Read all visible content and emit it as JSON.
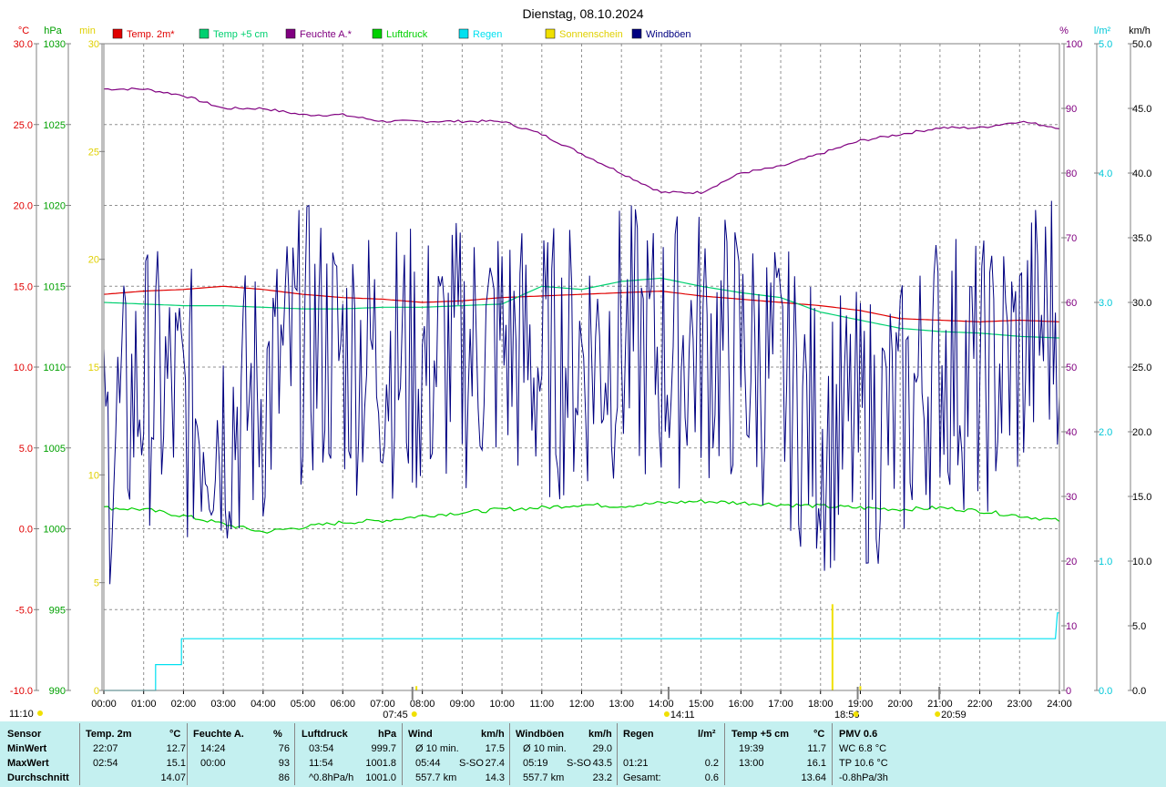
{
  "title": "Dienstag, 08.10.2024",
  "time_marker": "11:10",
  "axis_units": {
    "temp": "°C",
    "pressure": "hPa",
    "sun": "min",
    "humidity": "%",
    "rain": "l/m²",
    "wind": "km/h"
  },
  "legend": [
    {
      "label": "Temp. 2m*",
      "color": "#e00000"
    },
    {
      "label": "Temp +5 cm",
      "color": "#00d070"
    },
    {
      "label": "Feuchte A.*",
      "color": "#800080"
    },
    {
      "label": "Luftdruck",
      "color": "#00d000"
    },
    {
      "label": "Regen",
      "color": "#00e0f0"
    },
    {
      "label": "Sonnenschein",
      "color": "#f0e000"
    },
    {
      "label": "Windböen",
      "color": "#000080"
    }
  ],
  "events": [
    {
      "time": "07:45",
      "label": "07:45"
    },
    {
      "time": "14:11",
      "label": "14:11"
    },
    {
      "time": "18:56",
      "label": "18:56"
    },
    {
      "time": "20:59",
      "label": "20:59"
    }
  ],
  "chart_data": {
    "type": "line",
    "title": "Dienstag, 08.10.2024",
    "x_ticks": [
      "00:00",
      "01:00",
      "02:00",
      "03:00",
      "04:00",
      "05:00",
      "06:00",
      "07:00",
      "08:00",
      "09:00",
      "10:00",
      "11:00",
      "12:00",
      "13:00",
      "14:00",
      "15:00",
      "16:00",
      "17:00",
      "18:00",
      "19:00",
      "20:00",
      "21:00",
      "22:00",
      "23:00",
      "24:00"
    ],
    "axes": {
      "temp": {
        "unit": "°C",
        "range": [
          -10,
          30
        ],
        "ticks": [
          "-10.0",
          "-5.0",
          "0.0",
          "5.0",
          "10.0",
          "15.0",
          "20.0",
          "25.0",
          "30.0"
        ]
      },
      "pressure": {
        "unit": "hPa",
        "range": [
          990,
          1030
        ],
        "ticks": [
          "990",
          "995",
          "1000",
          "1005",
          "1010",
          "1015",
          "1020",
          "1025",
          "1030"
        ]
      },
      "sun": {
        "unit": "min",
        "range": [
          0,
          30
        ],
        "ticks": [
          "0",
          "5",
          "10",
          "15",
          "20",
          "25",
          "30"
        ]
      },
      "humidity": {
        "unit": "%",
        "range": [
          0,
          100
        ],
        "ticks": [
          "0",
          "10",
          "20",
          "30",
          "40",
          "50",
          "60",
          "70",
          "80",
          "90",
          "100"
        ]
      },
      "rain": {
        "unit": "l/m²",
        "range": [
          0,
          5
        ],
        "ticks": [
          "0.0",
          "1.0",
          "2.0",
          "3.0",
          "4.0",
          "5.0"
        ]
      },
      "wind": {
        "unit": "km/h",
        "range": [
          0,
          50
        ],
        "ticks": [
          "0.0",
          "5.0",
          "10.0",
          "15.0",
          "20.0",
          "25.0",
          "30.0",
          "35.0",
          "40.0",
          "45.0",
          "50.0"
        ]
      }
    },
    "series": [
      {
        "name": "Temp. 2m*",
        "axis": "temp",
        "color": "#e00000",
        "x": [
          0,
          1,
          2,
          3,
          4,
          5,
          6,
          7,
          8,
          9,
          10,
          11,
          12,
          13,
          14,
          15,
          16,
          17,
          18,
          19,
          20,
          21,
          22,
          23,
          24
        ],
        "y": [
          14.5,
          14.7,
          14.8,
          15.0,
          14.8,
          14.5,
          14.3,
          14.2,
          14.0,
          14.1,
          14.3,
          14.4,
          14.5,
          14.6,
          14.7,
          14.4,
          14.2,
          14.0,
          13.8,
          13.5,
          13.0,
          12.9,
          12.8,
          12.9,
          12.8
        ]
      },
      {
        "name": "Temp +5 cm",
        "axis": "temp",
        "color": "#00d070",
        "x": [
          0,
          1,
          2,
          3,
          4,
          5,
          6,
          7,
          8,
          9,
          10,
          11,
          12,
          13,
          14,
          15,
          16,
          17,
          18,
          19,
          20,
          21,
          22,
          23,
          24
        ],
        "y": [
          14.0,
          13.9,
          13.8,
          13.8,
          13.7,
          13.6,
          13.6,
          13.7,
          13.7,
          13.8,
          13.9,
          15.0,
          14.8,
          15.3,
          15.5,
          15.0,
          14.6,
          14.3,
          13.4,
          12.9,
          12.4,
          12.2,
          12.1,
          11.9,
          11.8
        ]
      },
      {
        "name": "Feuchte A.*",
        "axis": "humidity",
        "color": "#800080",
        "x": [
          0,
          1,
          2,
          3,
          4,
          5,
          6,
          7,
          8,
          9,
          10,
          11,
          12,
          13,
          14,
          15,
          16,
          17,
          18,
          19,
          20,
          21,
          22,
          23,
          24
        ],
        "y": [
          93,
          93,
          92,
          90,
          90,
          89,
          89,
          88,
          88,
          88,
          88,
          86,
          83,
          80,
          77,
          77,
          80,
          81,
          83,
          85,
          86,
          87,
          87,
          88,
          87
        ]
      },
      {
        "name": "Luftdruck",
        "axis": "pressure",
        "color": "#00d000",
        "x": [
          0,
          1,
          2,
          3,
          4,
          5,
          6,
          7,
          8,
          9,
          10,
          11,
          12,
          13,
          14,
          15,
          16,
          17,
          18,
          19,
          20,
          21,
          22,
          23,
          24
        ],
        "y": [
          1001.3,
          1001.2,
          1000.8,
          1000.3,
          999.8,
          1000.1,
          1000.4,
          1000.5,
          1000.8,
          1001.0,
          1001.2,
          1001.3,
          1001.5,
          1001.4,
          1001.6,
          1001.7,
          1001.6,
          1001.5,
          1001.4,
          1001.3,
          1001.2,
          1001.3,
          1001.1,
          1000.8,
          1000.5
        ]
      },
      {
        "name": "Regen",
        "axis": "rain",
        "color": "#00e0f0",
        "x": [
          0,
          1.3,
          1.3,
          1.95,
          1.95,
          23.9,
          23.95,
          24
        ],
        "y": [
          0,
          0,
          0.2,
          0.2,
          0.4,
          0.4,
          0.6,
          0.6
        ]
      },
      {
        "name": "Windböen",
        "axis": "wind",
        "color": "#000080",
        "x": [
          0,
          1,
          2,
          3,
          4,
          5,
          6,
          7,
          8,
          9,
          10,
          11,
          12,
          13,
          14,
          15,
          16,
          17,
          18,
          19,
          20,
          21,
          22,
          23,
          24
        ],
        "y": [
          18,
          24,
          22,
          21,
          23,
          27,
          26,
          26,
          25,
          26,
          27,
          25,
          26,
          27,
          26,
          27,
          26,
          24,
          20,
          20,
          21,
          26,
          24,
          26,
          30
        ]
      }
    ],
    "sunshine": [
      {
        "x": 18.3,
        "y": 4
      },
      {
        "x": 19.0,
        "y": 0.2
      },
      {
        "x": 7.85,
        "y": 0.2
      }
    ]
  },
  "summary": {
    "sensor": {
      "head": "Sensor",
      "rows": [
        "MinWert",
        "MaxWert",
        "Durchschnitt"
      ]
    },
    "temp": {
      "head": "Temp. 2m",
      "unit": "°C",
      "rows": [
        [
          "22:07",
          "12.7"
        ],
        [
          "02:54",
          "15.1"
        ],
        [
          "",
          "14.07"
        ]
      ]
    },
    "humidity": {
      "head": "Feuchte A.",
      "unit": "%",
      "rows": [
        [
          "14:24",
          "76"
        ],
        [
          "00:00",
          "93"
        ],
        [
          "",
          "86"
        ]
      ]
    },
    "pressure": {
      "head": "Luftdruck",
      "unit": "hPa",
      "rows": [
        [
          "03:54",
          "999.7"
        ],
        [
          "11:54",
          "1001.8"
        ],
        [
          "^0.8hPa/h",
          "1001.0"
        ]
      ]
    },
    "wind": {
      "head": "Wind",
      "unit": "km/h",
      "rows": [
        [
          "Ø 10 min.",
          "",
          "17.5"
        ],
        [
          "05:44",
          "S-SO",
          "27.4"
        ],
        [
          "557.7 km",
          "",
          "14.3"
        ]
      ]
    },
    "gusts": {
      "head": "Windböen",
      "unit": "km/h",
      "rows": [
        [
          "Ø 10 min.",
          "",
          "29.0"
        ],
        [
          "05:19",
          "S-SO",
          "43.5"
        ],
        [
          "557.7 km",
          "",
          "23.2"
        ]
      ]
    },
    "rain": {
      "head": "Regen",
      "unit": "l/m²",
      "rows": [
        [
          "",
          ""
        ],
        [
          "01:21",
          "0.2"
        ],
        [
          "Gesamt:",
          "0.6"
        ]
      ]
    },
    "ground": {
      "head": "Temp +5 cm",
      "unit": "°C",
      "rows": [
        [
          "19:39",
          "11.7"
        ],
        [
          "13:00",
          "16.1"
        ],
        [
          "",
          "13.64"
        ]
      ]
    },
    "pmv": {
      "head": "PMV 0.6",
      "rows": [
        "WC 6.8 °C",
        "TP 10.6 °C",
        "-0.8hPa/3h"
      ]
    }
  }
}
